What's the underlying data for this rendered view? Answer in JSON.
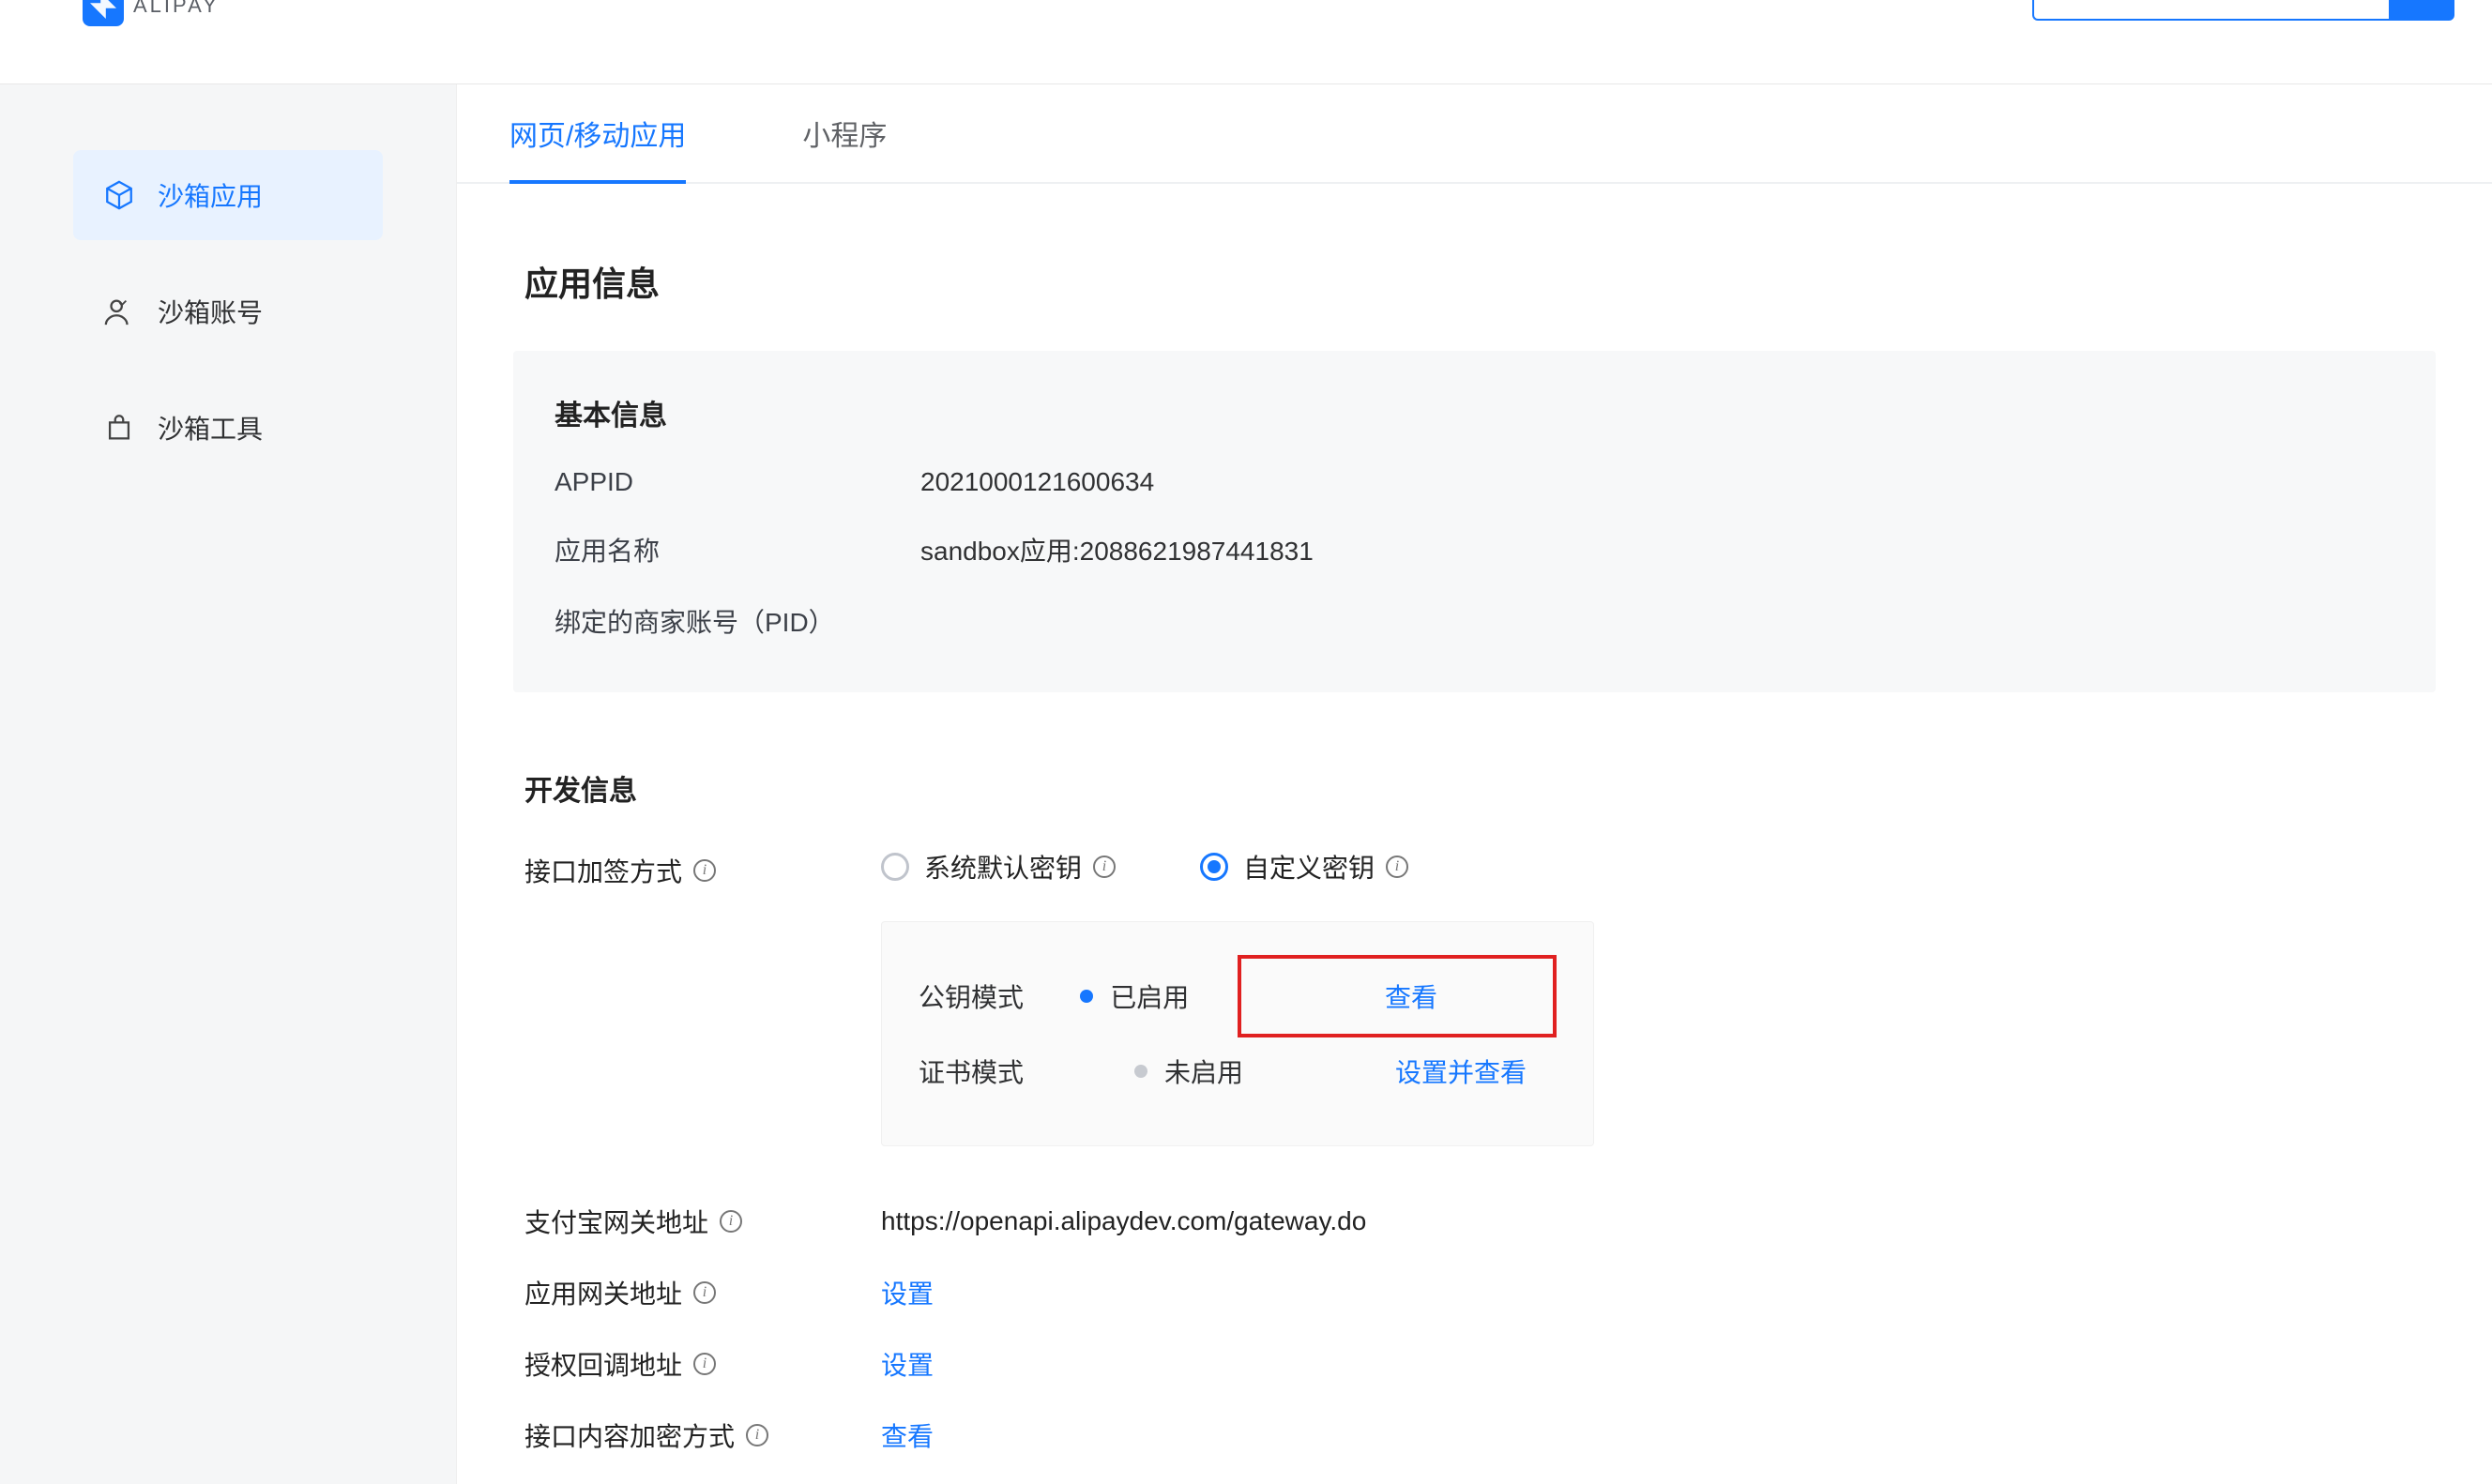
{
  "brand": "ALIPAY",
  "sidebar": {
    "items": [
      {
        "label": "沙箱应用",
        "active": true
      },
      {
        "label": "沙箱账号",
        "active": false
      },
      {
        "label": "沙箱工具",
        "active": false
      }
    ]
  },
  "tabs": [
    {
      "label": "网页/移动应用",
      "active": true
    },
    {
      "label": "小程序",
      "active": false
    }
  ],
  "section_app_info_title": "应用信息",
  "basic": {
    "title": "基本信息",
    "appid_label": "APPID",
    "appid": "2021000121600634",
    "name_label": "应用名称",
    "name": "sandbox应用:2088621987441831",
    "pid_label": "绑定的商家账号（PID）",
    "pid": ""
  },
  "dev": {
    "title": "开发信息",
    "sign_label": "接口加签方式",
    "radio_default": "系统默认密钥",
    "radio_custom": "自定义密钥",
    "key_public_label": "公钥模式",
    "key_cert_label": "证书模式",
    "status_enabled": "已启用",
    "status_disabled": "未启用",
    "view": "查看",
    "set_and_view": "设置并查看",
    "gateway_label": "支付宝网关地址",
    "gateway_value": "https://openapi.alipaydev.com/gateway.do",
    "app_gateway_label": "应用网关地址",
    "auth_callback_label": "授权回调地址",
    "encrypt_label": "接口内容加密方式",
    "set": "设置"
  }
}
